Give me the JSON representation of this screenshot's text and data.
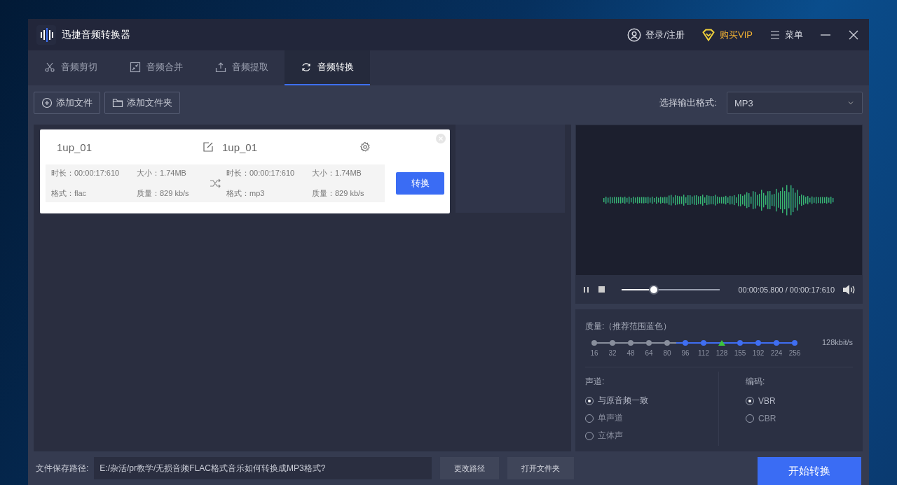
{
  "app": {
    "title": "迅捷音频转换器"
  },
  "header_actions": [
    {
      "kind": "user",
      "label": "登录/注册"
    },
    {
      "kind": "vip",
      "label": "购买VIP"
    },
    {
      "kind": "menu",
      "label": "菜单"
    }
  ],
  "tabs": [
    {
      "kind": "cut",
      "label": "音频剪切",
      "selected": false
    },
    {
      "kind": "merge",
      "label": "音频合并",
      "selected": false
    },
    {
      "kind": "extract",
      "label": "音频提取",
      "selected": false
    },
    {
      "kind": "convert",
      "label": "音频转换",
      "selected": true
    }
  ],
  "toolbar": {
    "buttons": [
      {
        "kind": "add-file",
        "label": "添加文件"
      },
      {
        "kind": "add-folder",
        "label": "添加文件夹"
      }
    ],
    "format_label": "选择输出格式:",
    "format_value": "MP3"
  },
  "files": [
    {
      "source_name": "1up_01",
      "output_name": "1up_01",
      "source": {
        "duration": "时长：00:00:17:610",
        "size": "大小：1.74MB",
        "format": "格式：flac",
        "quality": "质量：829 kb/s"
      },
      "output": {
        "duration": "时长：00:00:17:610",
        "size": "大小：1.74MB",
        "format": "格式：mp3",
        "quality": "质量：829 kb/s"
      },
      "convert_button": "转换"
    }
  ],
  "player": {
    "level": 0.33,
    "time": "00:00:05.800 / 00:00:17:610"
  },
  "quality": {
    "label": "质量:（推荐范围蓝色）",
    "reading": "128kbit/s",
    "options": [
      {
        "label": "16",
        "recommended": false,
        "selected": false
      },
      {
        "label": "32",
        "recommended": false,
        "selected": false
      },
      {
        "label": "48",
        "recommended": false,
        "selected": false
      },
      {
        "label": "64",
        "recommended": false,
        "selected": false
      },
      {
        "label": "80",
        "recommended": false,
        "selected": false
      },
      {
        "label": "96",
        "recommended": true,
        "selected": false
      },
      {
        "label": "112",
        "recommended": true,
        "selected": false
      },
      {
        "label": "128",
        "recommended": true,
        "selected": true
      },
      {
        "label": "155",
        "recommended": true,
        "selected": false
      },
      {
        "label": "192",
        "recommended": true,
        "selected": false
      },
      {
        "label": "224",
        "recommended": true,
        "selected": false
      },
      {
        "label": "256",
        "recommended": true,
        "selected": false
      }
    ]
  },
  "channel": {
    "label": "声道:",
    "options": [
      {
        "label": "与原音频一致",
        "selected": true
      },
      {
        "label": "单声道",
        "selected": false
      },
      {
        "label": "立体声",
        "selected": false
      }
    ]
  },
  "encoding": {
    "label": "编码:",
    "options": [
      {
        "label": "VBR",
        "selected": true
      },
      {
        "label": "CBR",
        "selected": false
      }
    ]
  },
  "bottom": {
    "path_label": "文件保存路径:",
    "path_value": "E:/杂活/pr教学/无损音频FLAC格式音乐如何转换成MP3格式?",
    "buttons": [
      "更改路径",
      "打开文件夹"
    ],
    "start_button": "开始转换"
  }
}
